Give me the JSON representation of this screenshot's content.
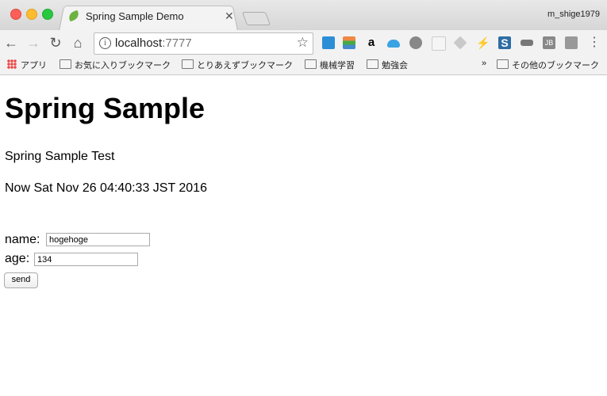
{
  "window": {
    "tab_title": "Spring Sample Demo",
    "profile": "m_shige1979"
  },
  "toolbar": {
    "url_host": "localhost",
    "url_port": ":7777"
  },
  "bookmarks": {
    "apps": "アプリ",
    "items": [
      "お気に入りブックマーク",
      "とりあえずブックマーク",
      "機械学習",
      "勉強会"
    ],
    "more": "»",
    "other": "その他のブックマーク"
  },
  "page": {
    "heading": "Spring Sample",
    "subtitle": "Spring Sample Test",
    "now_text": "Now Sat Nov 26 04:40:33 JST 2016",
    "form": {
      "name_label": "name:",
      "name_value": "hogehoge",
      "age_label": "age:",
      "age_value": "134",
      "send_label": "send"
    }
  }
}
